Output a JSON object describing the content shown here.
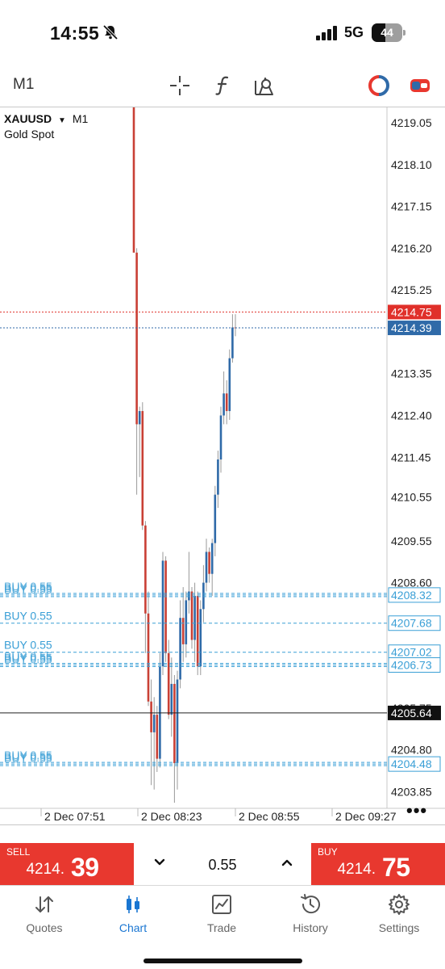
{
  "status": {
    "time": "14:55",
    "network": "5G",
    "battery": "44"
  },
  "toolbar": {
    "timeframe": "M1"
  },
  "chart": {
    "symbol": "XAUUSD",
    "timeframe": "M1",
    "description": "Gold Spot",
    "price_axis_labels": [
      "4219.05",
      "4218.10",
      "4217.15",
      "4216.20",
      "4215.25",
      "4213.35",
      "4212.40",
      "4211.45",
      "4210.55",
      "4209.55",
      "4208.60",
      "4205.75",
      "4204.80",
      "4203.85"
    ],
    "ask": "4214.75",
    "bid": "4214.39",
    "last_marker": "4205.64",
    "time_labels": [
      "2 Dec 07:51",
      "2 Dec 08:23",
      "2 Dec 08:55",
      "2 Dec 09:27"
    ],
    "orders": [
      {
        "label": "BUY 0.55",
        "price": "4208.32",
        "count": 3
      },
      {
        "label": "BUY 0.55",
        "price": "4207.68",
        "count": 1
      },
      {
        "label": "BUY 0.55",
        "price": "4207.02",
        "count": 1
      },
      {
        "label": "BUY 0.55",
        "price": "4206.73",
        "count": 3
      },
      {
        "label": "BUY 0.55",
        "price": "4204.48",
        "count": 3
      }
    ],
    "colors": {
      "ask_line": "#e0302a",
      "bid_line": "#2f6aa8",
      "order_line": "#3a9fd6",
      "bull": "#2f6aa8",
      "bear": "#c94035"
    }
  },
  "chart_data": {
    "type": "candlestick",
    "symbol": "XAUUSD",
    "timeframe": "M1",
    "ylim": [
      4203.4,
      4219.4
    ],
    "candles": [
      {
        "o": 4219.4,
        "h": 4219.4,
        "l": 4216.1,
        "c": 4216.1
      },
      {
        "o": 4216.1,
        "h": 4216.2,
        "l": 4210.6,
        "c": 4212.2
      },
      {
        "o": 4212.2,
        "h": 4212.6,
        "l": 4211.0,
        "c": 4212.5
      },
      {
        "o": 4212.5,
        "h": 4212.7,
        "l": 4209.8,
        "c": 4209.9
      },
      {
        "o": 4209.9,
        "h": 4210.0,
        "l": 4207.0,
        "c": 4207.9
      },
      {
        "o": 4207.9,
        "h": 4208.4,
        "l": 4205.8,
        "c": 4205.9
      },
      {
        "o": 4205.9,
        "h": 4206.4,
        "l": 4204.0,
        "c": 4205.2
      },
      {
        "o": 4205.2,
        "h": 4206.0,
        "l": 4203.9,
        "c": 4205.6
      },
      {
        "o": 4205.6,
        "h": 4205.8,
        "l": 4204.3,
        "c": 4204.6
      },
      {
        "o": 4204.6,
        "h": 4207.0,
        "l": 4204.4,
        "c": 4206.7
      },
      {
        "o": 4206.7,
        "h": 4209.3,
        "l": 4206.5,
        "c": 4209.1
      },
      {
        "o": 4209.1,
        "h": 4209.2,
        "l": 4206.8,
        "c": 4207.0
      },
      {
        "o": 4207.0,
        "h": 4207.3,
        "l": 4205.5,
        "c": 4205.6
      },
      {
        "o": 4205.6,
        "h": 4206.9,
        "l": 4205.1,
        "c": 4206.3
      },
      {
        "o": 4206.3,
        "h": 4206.5,
        "l": 4203.6,
        "c": 4204.5
      },
      {
        "o": 4204.5,
        "h": 4206.6,
        "l": 4203.9,
        "c": 4206.4
      },
      {
        "o": 4206.4,
        "h": 4208.2,
        "l": 4206.2,
        "c": 4207.8
      },
      {
        "o": 4207.8,
        "h": 4208.5,
        "l": 4206.8,
        "c": 4207.2
      },
      {
        "o": 4207.2,
        "h": 4208.4,
        "l": 4206.9,
        "c": 4208.2
      },
      {
        "o": 4208.2,
        "h": 4209.3,
        "l": 4207.9,
        "c": 4208.4
      },
      {
        "o": 4208.4,
        "h": 4208.5,
        "l": 4207.1,
        "c": 4207.3
      },
      {
        "o": 4207.3,
        "h": 4208.6,
        "l": 4206.8,
        "c": 4208.3
      },
      {
        "o": 4208.3,
        "h": 4208.4,
        "l": 4206.5,
        "c": 4206.7
      },
      {
        "o": 4206.7,
        "h": 4208.2,
        "l": 4206.5,
        "c": 4208.0
      },
      {
        "o": 4208.0,
        "h": 4209.0,
        "l": 4207.7,
        "c": 4208.6
      },
      {
        "o": 4208.6,
        "h": 4209.6,
        "l": 4208.4,
        "c": 4209.3
      },
      {
        "o": 4209.3,
        "h": 4209.4,
        "l": 4208.6,
        "c": 4208.8
      },
      {
        "o": 4208.8,
        "h": 4209.6,
        "l": 4208.3,
        "c": 4209.5
      },
      {
        "o": 4209.5,
        "h": 4210.8,
        "l": 4209.2,
        "c": 4210.6
      },
      {
        "o": 4210.6,
        "h": 4211.6,
        "l": 4210.3,
        "c": 4211.4
      },
      {
        "o": 4211.4,
        "h": 4212.6,
        "l": 4211.1,
        "c": 4212.4
      },
      {
        "o": 4212.4,
        "h": 4213.4,
        "l": 4212.2,
        "c": 4212.9
      },
      {
        "o": 4212.9,
        "h": 4213.2,
        "l": 4212.2,
        "c": 4212.5
      },
      {
        "o": 4212.5,
        "h": 4213.9,
        "l": 4212.3,
        "c": 4213.7
      },
      {
        "o": 4213.7,
        "h": 4214.7,
        "l": 4213.6,
        "c": 4214.4
      },
      {
        "o": 4214.4,
        "h": 4214.7,
        "l": 4214.2,
        "c": 4214.39
      }
    ]
  },
  "trade": {
    "sell_label": "SELL",
    "sell_main": "4214.",
    "sell_big": "39",
    "buy_label": "BUY",
    "buy_main": "4214.",
    "buy_big": "75",
    "volume": "0.55"
  },
  "nav": [
    {
      "label": "Quotes",
      "icon": "quotes-arrows-icon"
    },
    {
      "label": "Chart",
      "icon": "candlestick-chart-icon",
      "active": true
    },
    {
      "label": "Trade",
      "icon": "trade-chart-icon"
    },
    {
      "label": "History",
      "icon": "history-clock-icon"
    },
    {
      "label": "Settings",
      "icon": "settings-gear-icon"
    }
  ]
}
